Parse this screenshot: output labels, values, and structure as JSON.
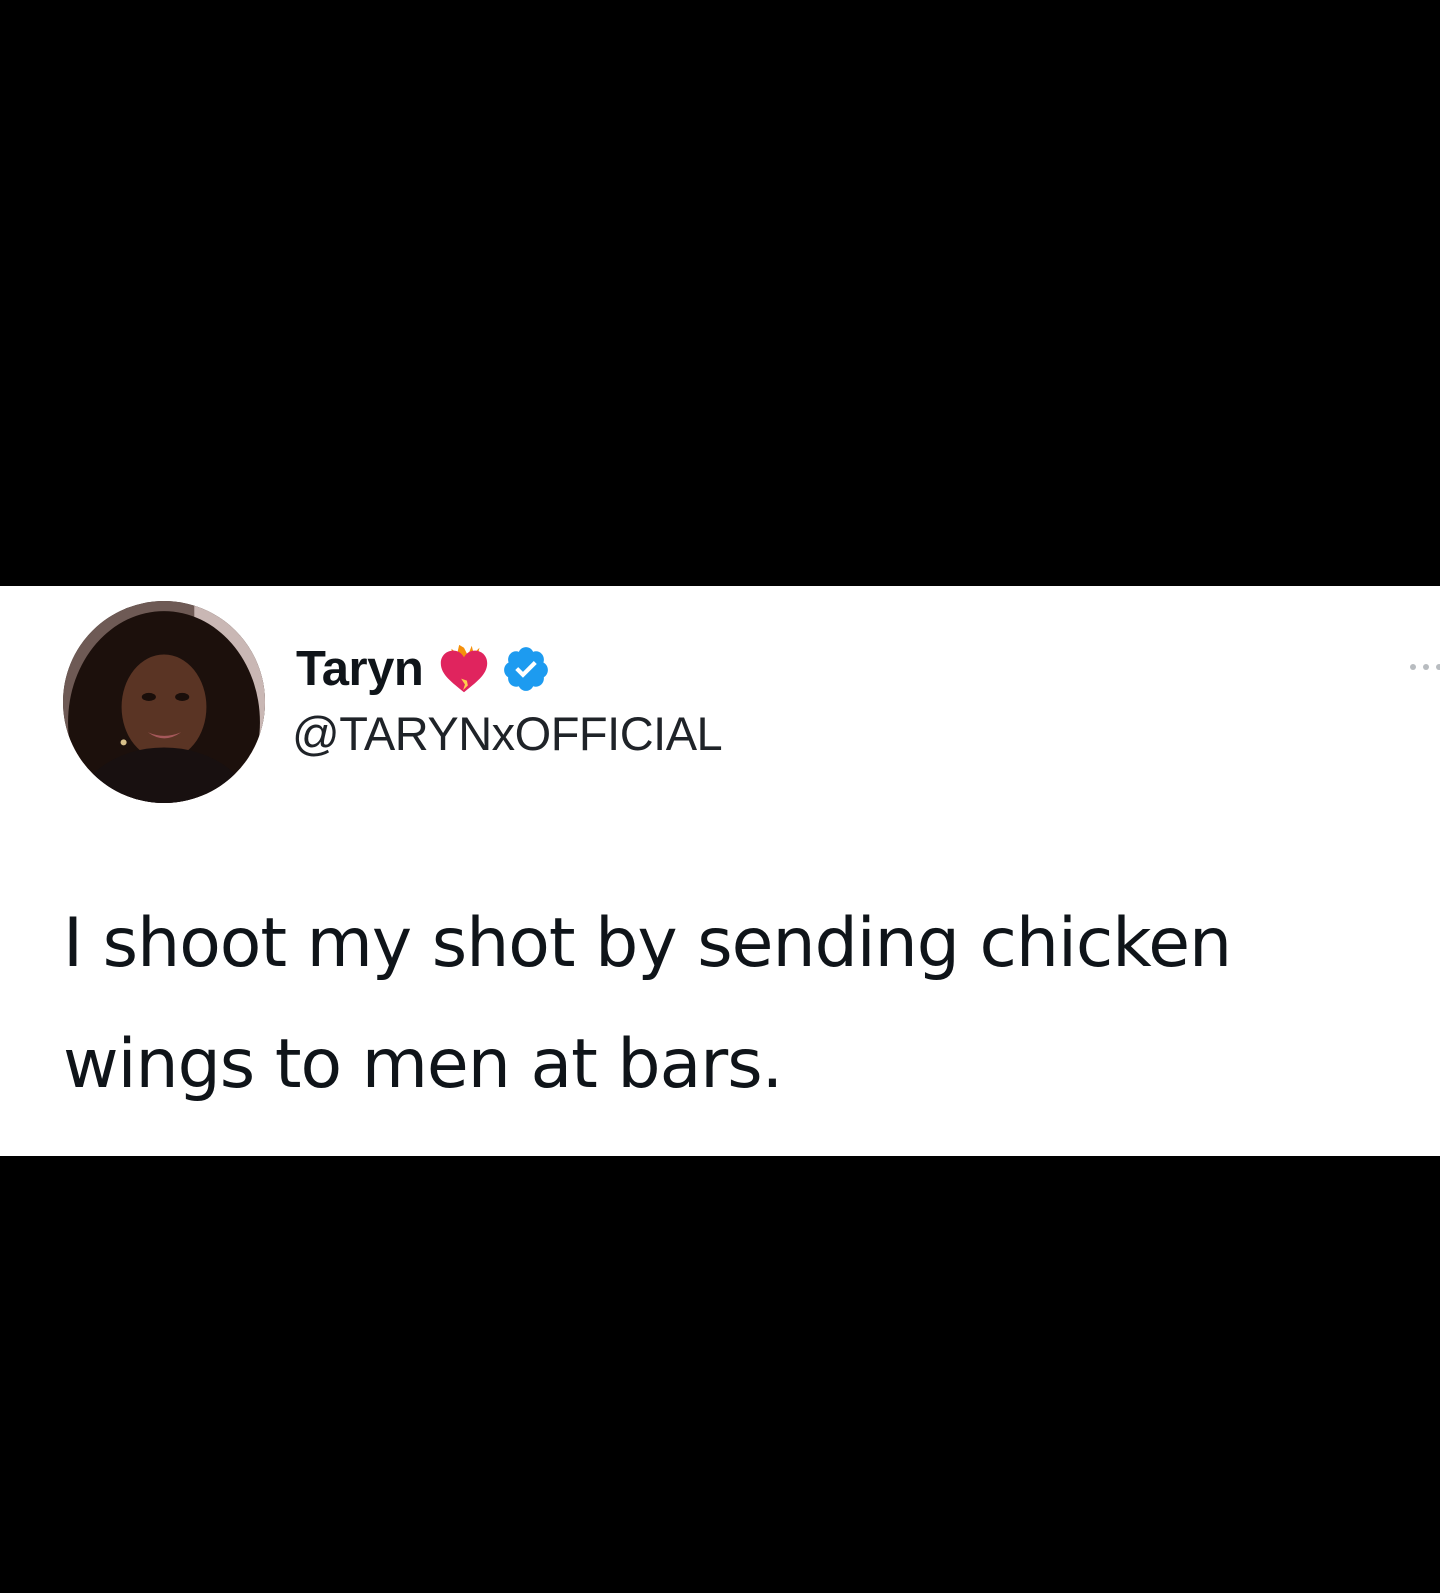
{
  "tweet": {
    "display_name": "Taryn",
    "handle": "@TARYNxOFFICIAL",
    "text": "I shoot my shot by sending chicken wings to men at bars.",
    "badge_icons": [
      "heart-on-fire-icon",
      "verified-badge-icon"
    ],
    "more_icon": "more-options-icon"
  },
  "colors": {
    "background": "#000000",
    "card": "#ffffff",
    "text": "#0f1419",
    "verified": "#1d9bf0",
    "heart": "#e0245e"
  }
}
